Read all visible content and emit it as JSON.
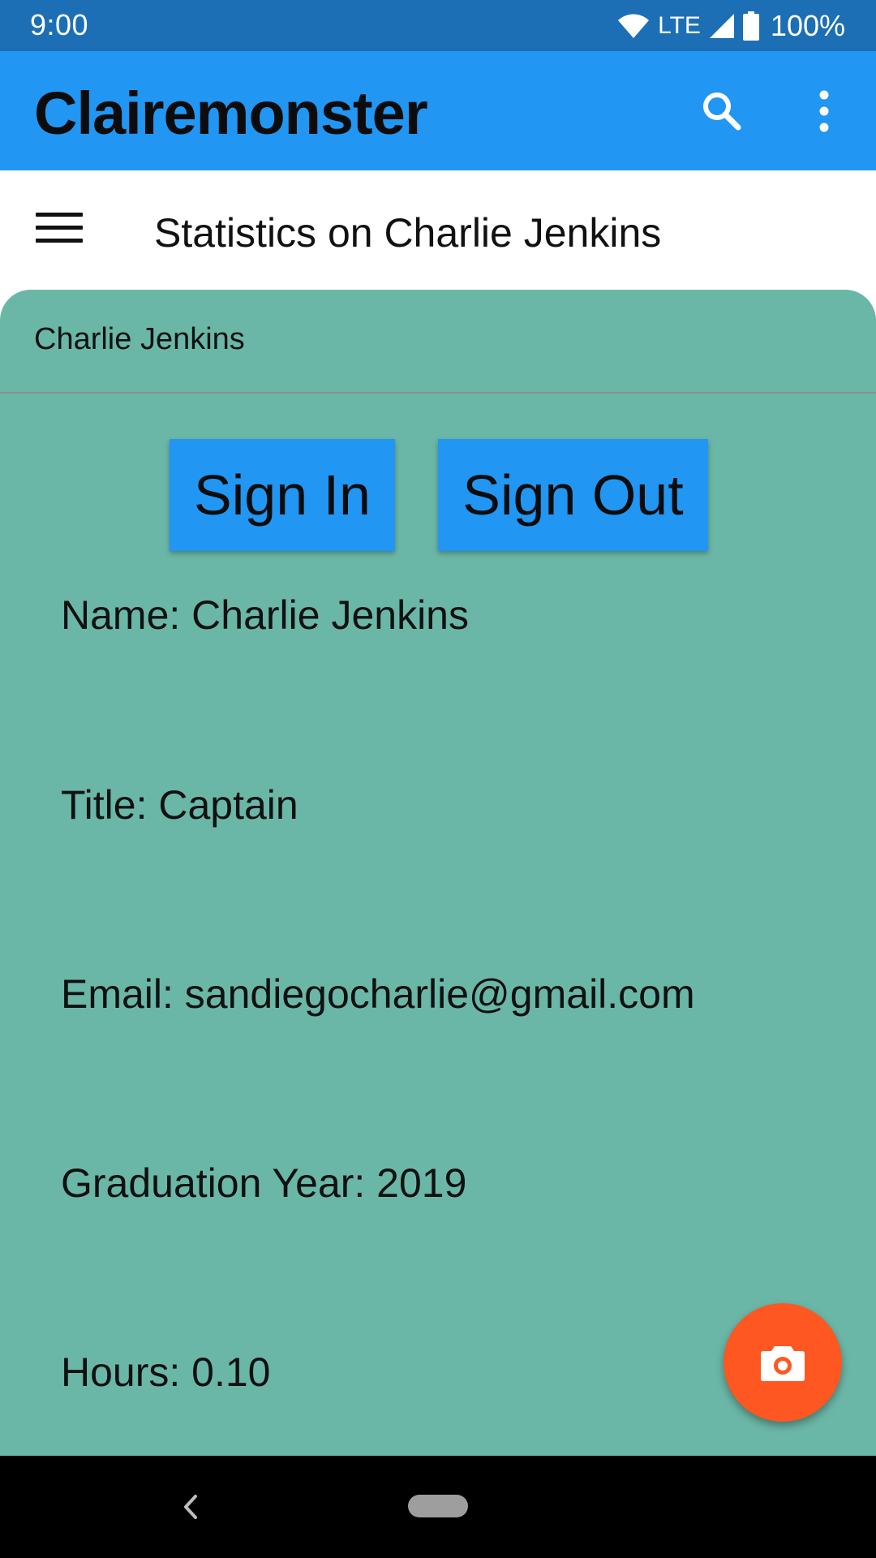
{
  "status_bar": {
    "time": "9:00",
    "network": "LTE",
    "battery": "100%"
  },
  "app_bar": {
    "title": "Clairemonster",
    "color": "#2196f3"
  },
  "sub_header": {
    "title": "Statistics on Charlie Jenkins"
  },
  "card": {
    "header": "Charlie Jenkins",
    "background": "#6bb7a7",
    "buttons": {
      "sign_in": "Sign In",
      "sign_out": "Sign Out"
    },
    "fields": [
      {
        "text": "Name: Charlie Jenkins"
      },
      {
        "text": "Title: Captain"
      },
      {
        "text": "Email: sandiegocharlie@gmail.com"
      },
      {
        "text": "Graduation Year: 2019"
      },
      {
        "text": "Hours: 0.10"
      }
    ]
  },
  "fab": {
    "icon": "camera-icon",
    "color": "#ff5722"
  },
  "nav_bar": {
    "icons": [
      "back-icon",
      "home-pill-icon"
    ]
  }
}
